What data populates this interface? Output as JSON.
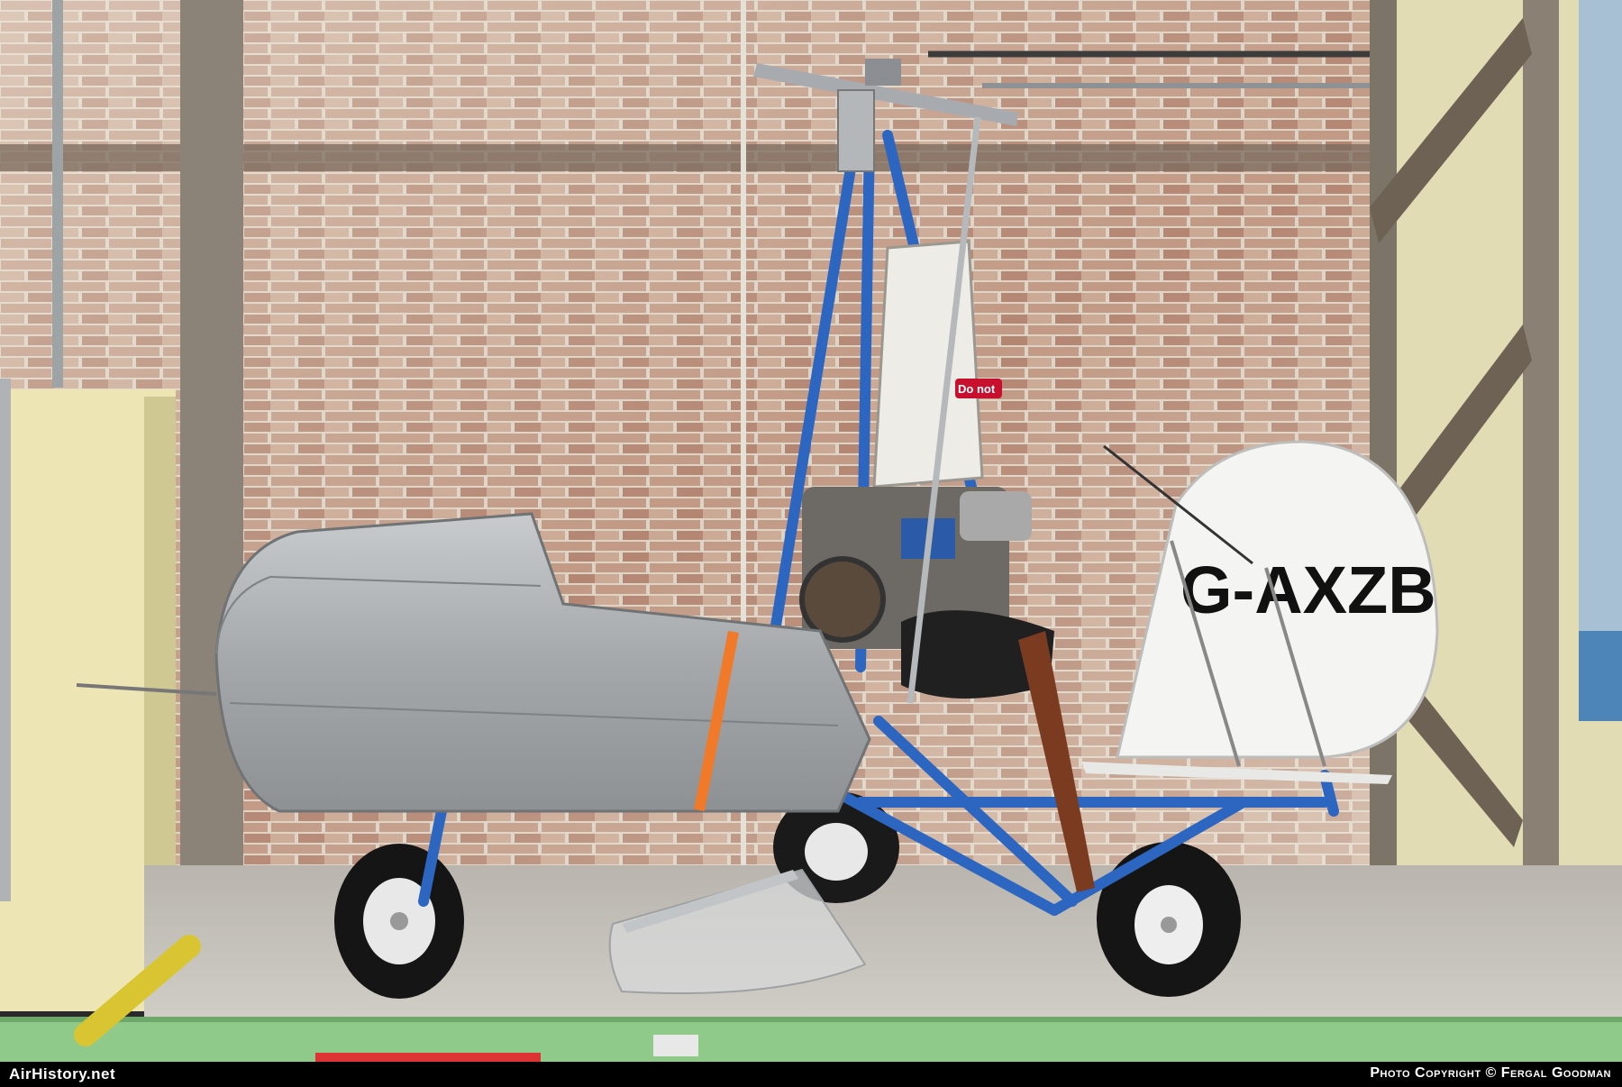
{
  "photo": {
    "registration": "G-AXZB",
    "sticker_text": "Do not"
  },
  "footer": {
    "site": "AirHistory.net",
    "credit": "Photo Copyright © Fergal Goodman"
  },
  "colors": {
    "brick": "#b07a62",
    "mortar": "#ddd6c8",
    "frame_blue": "#2c66c0",
    "aluminium": "#a9adb0",
    "floor": "#c9c6c0",
    "ledge_green": "#8fca8a"
  }
}
